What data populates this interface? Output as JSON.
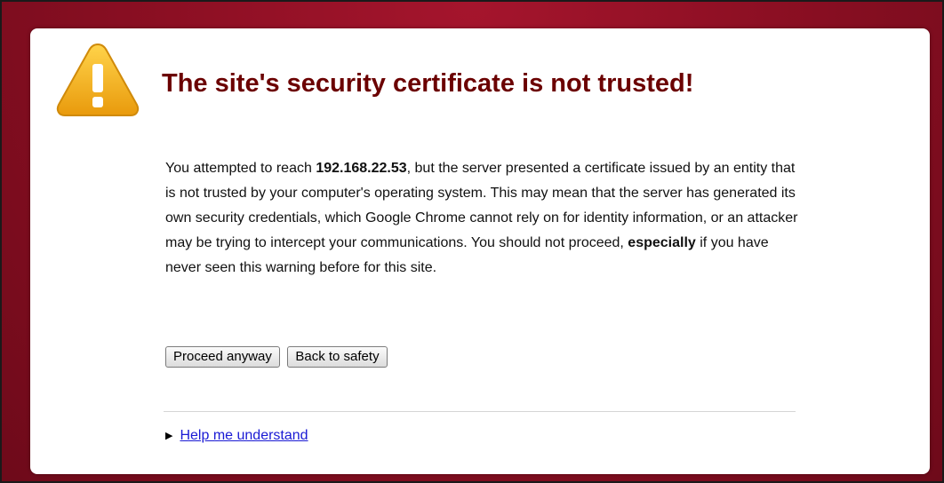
{
  "page": {
    "title": "The site's security certificate is not trusted!",
    "body": {
      "p1": "You attempted to reach ",
      "host": "192.168.22.53",
      "p2": ", but the server presented a certificate issued by an entity that is not trusted by your computer's operating system. This may mean that the server has generated its own security credentials, which Google Chrome cannot rely on for identity information, or an attacker may be trying to intercept your communications. You should not proceed, ",
      "emphasis": "especially",
      "p3": " if you have never seen this warning before for this site."
    },
    "buttons": {
      "proceed": "Proceed anyway",
      "back": "Back to safety"
    },
    "help_link": "Help me understand",
    "help_arrow": "▶"
  },
  "colors": {
    "background": "#8c0f23",
    "title": "#6b0000",
    "link": "#1a1ad4",
    "warning_icon": "#f2b21b"
  },
  "icons": [
    "warning-icon",
    "disclosure-arrow-icon"
  ]
}
